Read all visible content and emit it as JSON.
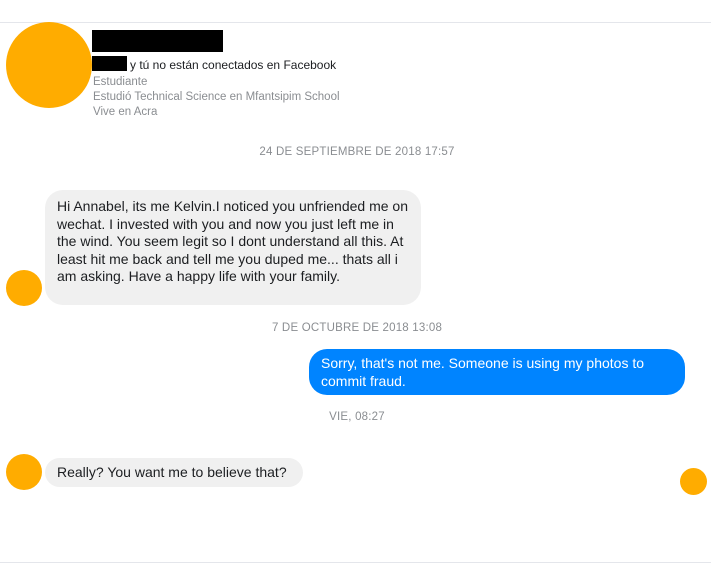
{
  "profile": {
    "connection_text": "y tú no están conectados en Facebook",
    "details": [
      "Estudiante",
      "Estudió Technical Science en Mfantsipim School",
      "Vive en Acra"
    ]
  },
  "conversation": {
    "timestamps": [
      "24 DE SEPTIEMBRE DE 2018 17:57",
      "7 DE OCTUBRE DE 2018 13:08",
      "VIE, 08:27"
    ],
    "messages": [
      {
        "direction": "incoming",
        "text": "Hi Annabel, its me Kelvin.I noticed you unfriended me on wechat. I invested with you and now you just left me in the wind. You seem legit so I dont understand all this. At least hit me back and tell me you duped me... thats all i am asking. Have a happy life with your family."
      },
      {
        "direction": "outgoing",
        "text": "Sorry, that's not me. Someone is using my photos to commit fraud."
      },
      {
        "direction": "incoming",
        "text": "Really? You want me to believe that?"
      }
    ]
  },
  "colors": {
    "avatar": "#ffac00",
    "outgoing_bubble": "#0084ff",
    "incoming_bubble": "#f0f0f0",
    "meta_text": "#8a8d91"
  }
}
